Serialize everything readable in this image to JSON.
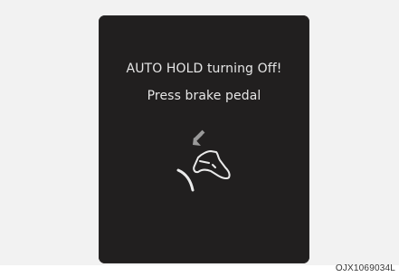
{
  "display": {
    "message_line1": "AUTO HOLD turning Off!",
    "message_line2": "Press brake pedal",
    "icon": "press-brake-pedal-icon",
    "background_color": "#211f1f",
    "text_color": "#e6e6e6"
  },
  "figure_code": "OJX1069034L"
}
